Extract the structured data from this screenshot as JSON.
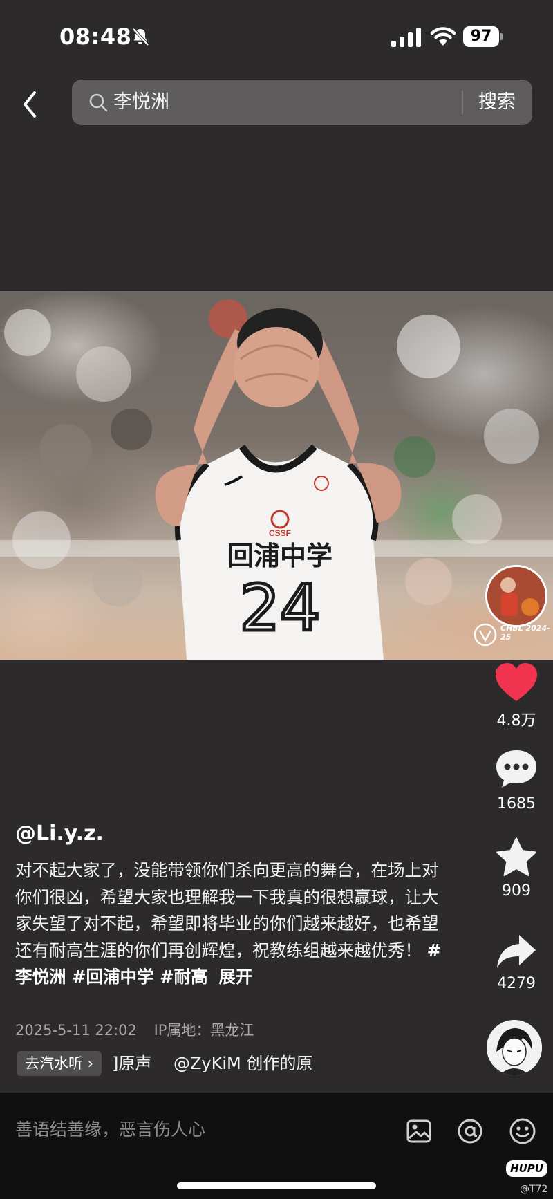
{
  "status_bar": {
    "time": "08:48",
    "battery": "97"
  },
  "search": {
    "query": "李悦洲",
    "button_label": "搜索"
  },
  "video": {
    "jersey_school": "回浦中学",
    "jersey_number": "24",
    "jersey_logo": "CSSF",
    "overlay_badge": "CHBL 2024-25"
  },
  "actions": {
    "like_count": "4.8万",
    "comment_count": "1685",
    "favorite_count": "909",
    "share_count": "4279"
  },
  "post": {
    "author": "@Li.y.z.",
    "description": "对不起大家了，没能带领你们杀向更高的舞台，在场上对你们很凶，希望大家也理解我一下我真的很想赢球，让大家失望了对不起，希望即将毕业的你们越来越好，也希望还有耐高生涯的你们再创辉煌，祝教练组越来越优秀！",
    "hashtags": "#李悦洲 #回浦中学 #耐高",
    "expand_label": "展开",
    "date": "2025-5-11 22:02",
    "ip_location": "IP属地：黑龙江"
  },
  "music": {
    "go_listen_label": "去汽水听 ›",
    "track": "]原声　 @ZyKiM 创作的原"
  },
  "bottom_bar": {
    "comment_placeholder": "善语结善缘，恶言伤人心"
  },
  "watermark": {
    "brand": "HUPU",
    "user": "@T72"
  },
  "colors": {
    "background": "#2c2a2a",
    "like_red": "#f0334f",
    "bottom_bar": "#111010"
  }
}
